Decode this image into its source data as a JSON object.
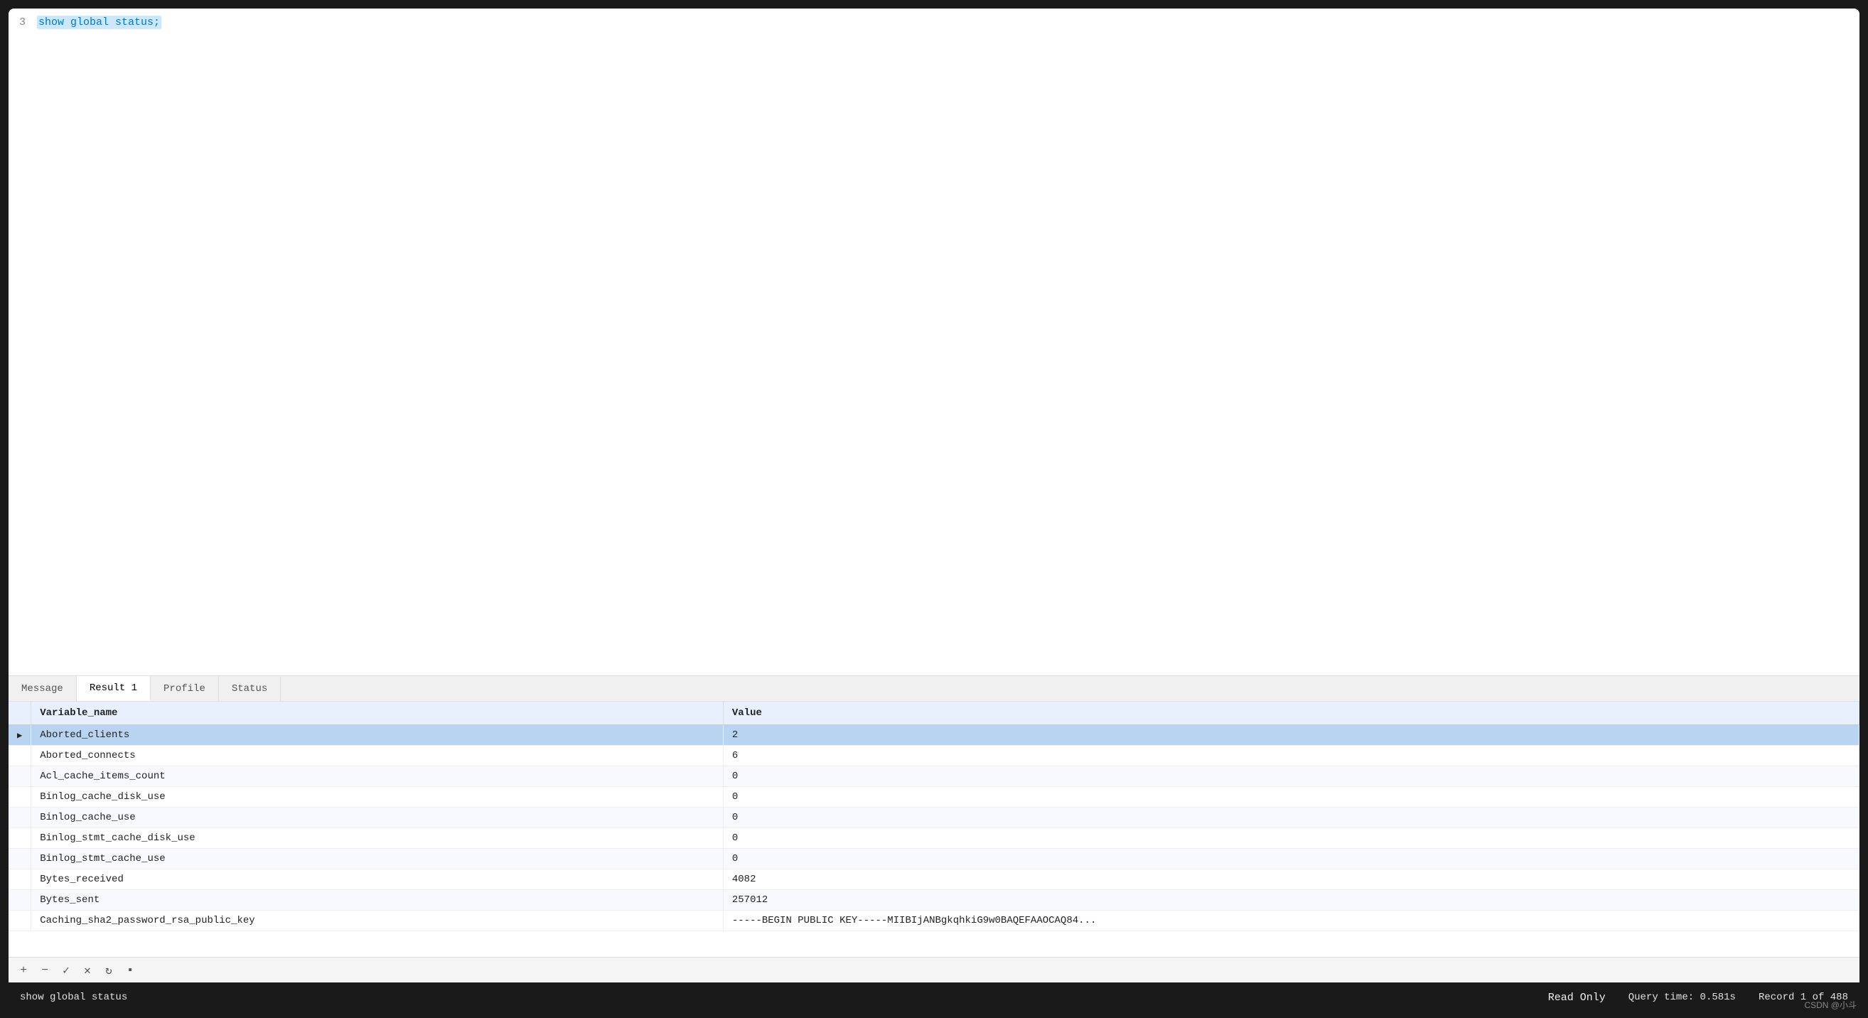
{
  "editor": {
    "lines": [
      {
        "number": "3",
        "content": "show global status;",
        "highlighted": true
      }
    ]
  },
  "tabs": [
    {
      "id": "message",
      "label": "Message",
      "active": false
    },
    {
      "id": "result1",
      "label": "Result 1",
      "active": true
    },
    {
      "id": "profile",
      "label": "Profile",
      "active": false
    },
    {
      "id": "status",
      "label": "Status",
      "active": false
    }
  ],
  "table": {
    "columns": [
      {
        "id": "variable_name",
        "label": "Variable_name"
      },
      {
        "id": "value",
        "label": "Value"
      }
    ],
    "rows": [
      {
        "variable_name": "Aborted_clients",
        "value": "2",
        "selected": true
      },
      {
        "variable_name": "Aborted_connects",
        "value": "6",
        "selected": false
      },
      {
        "variable_name": "Acl_cache_items_count",
        "value": "0",
        "selected": false
      },
      {
        "variable_name": "Binlog_cache_disk_use",
        "value": "0",
        "selected": false
      },
      {
        "variable_name": "Binlog_cache_use",
        "value": "0",
        "selected": false
      },
      {
        "variable_name": "Binlog_stmt_cache_disk_use",
        "value": "0",
        "selected": false
      },
      {
        "variable_name": "Binlog_stmt_cache_use",
        "value": "0",
        "selected": false
      },
      {
        "variable_name": "Bytes_received",
        "value": "4082",
        "selected": false
      },
      {
        "variable_name": "Bytes_sent",
        "value": "257012",
        "selected": false
      },
      {
        "variable_name": "Caching_sha2_password_rsa_public_key",
        "value": "-----BEGIN PUBLIC KEY-----MIIBIjANBgkqhkiG9w0BAQEFAAOCAQ84...",
        "selected": false
      }
    ]
  },
  "toolbar": {
    "buttons": [
      {
        "id": "add",
        "icon": "+",
        "label": "Add row"
      },
      {
        "id": "delete",
        "icon": "−",
        "label": "Delete row"
      },
      {
        "id": "apply",
        "icon": "✓",
        "label": "Apply changes"
      },
      {
        "id": "discard",
        "icon": "✕",
        "label": "Discard changes"
      },
      {
        "id": "refresh",
        "icon": "↻",
        "label": "Refresh"
      },
      {
        "id": "more",
        "icon": "▪",
        "label": "More options"
      }
    ]
  },
  "statusbar": {
    "query_text": "show global status",
    "read_only": "Read Only",
    "query_time_label": "Query time:",
    "query_time_value": "0.581s",
    "record_label": "Record 1 of 488"
  },
  "watermark": "CSDN @小斗"
}
